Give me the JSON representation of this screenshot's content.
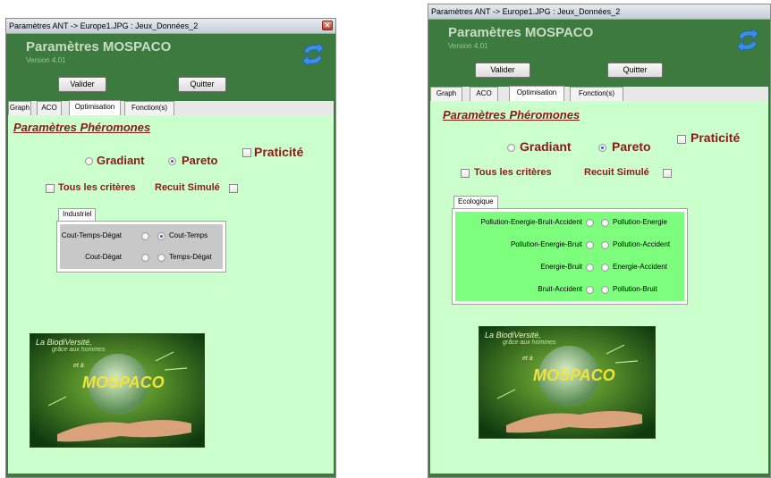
{
  "windowA": {
    "title": "Paramètres ANT -> Europe1.JPG : Jeux_Données_2",
    "app_title": "Paramètres MOSPACO",
    "version": "Version 4.01",
    "buttons": {
      "valider": "Valider",
      "quitter": "Quitter"
    },
    "tabs": [
      "Graph",
      "ACO",
      "Optimisation",
      "Fonction(s)"
    ],
    "active_tab": "Optimisation",
    "section_title": "Paramètres Phéromones",
    "radio_gradiant": "Gradiant",
    "radio_pareto": "Pareto",
    "selected_method": "Pareto",
    "praticite": "Praticité",
    "tous_criteres": "Tous les critères",
    "recuit_simule": "Recuit Simulé",
    "group": {
      "tab": "Industriel",
      "rows": [
        {
          "left": "Cout-Temps-Dégat",
          "right": "Cout-Temps",
          "selected": "right"
        },
        {
          "left": "Cout-Dégat",
          "right": "Temps-Dégat",
          "selected": "none"
        }
      ]
    },
    "image_text": {
      "line1": "La BiodiVersité,",
      "line2": "grâce aux hommes",
      "line3": "et à",
      "logo": "MOSPACO"
    }
  },
  "windowB": {
    "title": "Paramètres ANT -> Europe1.JPG : Jeux_Données_2",
    "app_title": "Paramètres MOSPACO",
    "version": "Version 4.01",
    "buttons": {
      "valider": "Valider",
      "quitter": "Quitter"
    },
    "tabs": [
      "Graph",
      "ACO",
      "Optimisation",
      "Fonction(s)"
    ],
    "active_tab": "Optimisation",
    "section_title": "Paramètres Phéromones",
    "radio_gradiant": "Gradiant",
    "radio_pareto": "Pareto",
    "selected_method": "Pareto",
    "praticite": "Praticité",
    "tous_criteres": "Tous les critères",
    "recuit_simule": "Recuit Simulé",
    "group": {
      "tab": "Ecologique",
      "rows": [
        {
          "left": "Pollution-Energie-Bruit-Accident",
          "right": "Pollution-Energie",
          "selected": "none"
        },
        {
          "left": "Pollution-Energie-Bruit",
          "right": "Pollution-Accident",
          "selected": "none"
        },
        {
          "left": "Energie-Bruit",
          "right": "Energie-Accident",
          "selected": "none"
        },
        {
          "left": "Bruit-Accident",
          "right": "Pollution-Bruit",
          "selected": "none"
        }
      ]
    },
    "image_text": {
      "line1": "La BiodiVersité,",
      "line2": "grâce aux hommes",
      "line3": "et à",
      "logo": "MOSPACO"
    }
  },
  "colors": {
    "window_bg": "#3d7a3d",
    "panel_bg": "#cbffcb",
    "accent_red": "#8b1a1a",
    "industriel_bg": "#c8c8c8",
    "ecologique_bg": "#7dff7d"
  },
  "icons": [
    "refresh-arrows-icon",
    "close-icon"
  ]
}
